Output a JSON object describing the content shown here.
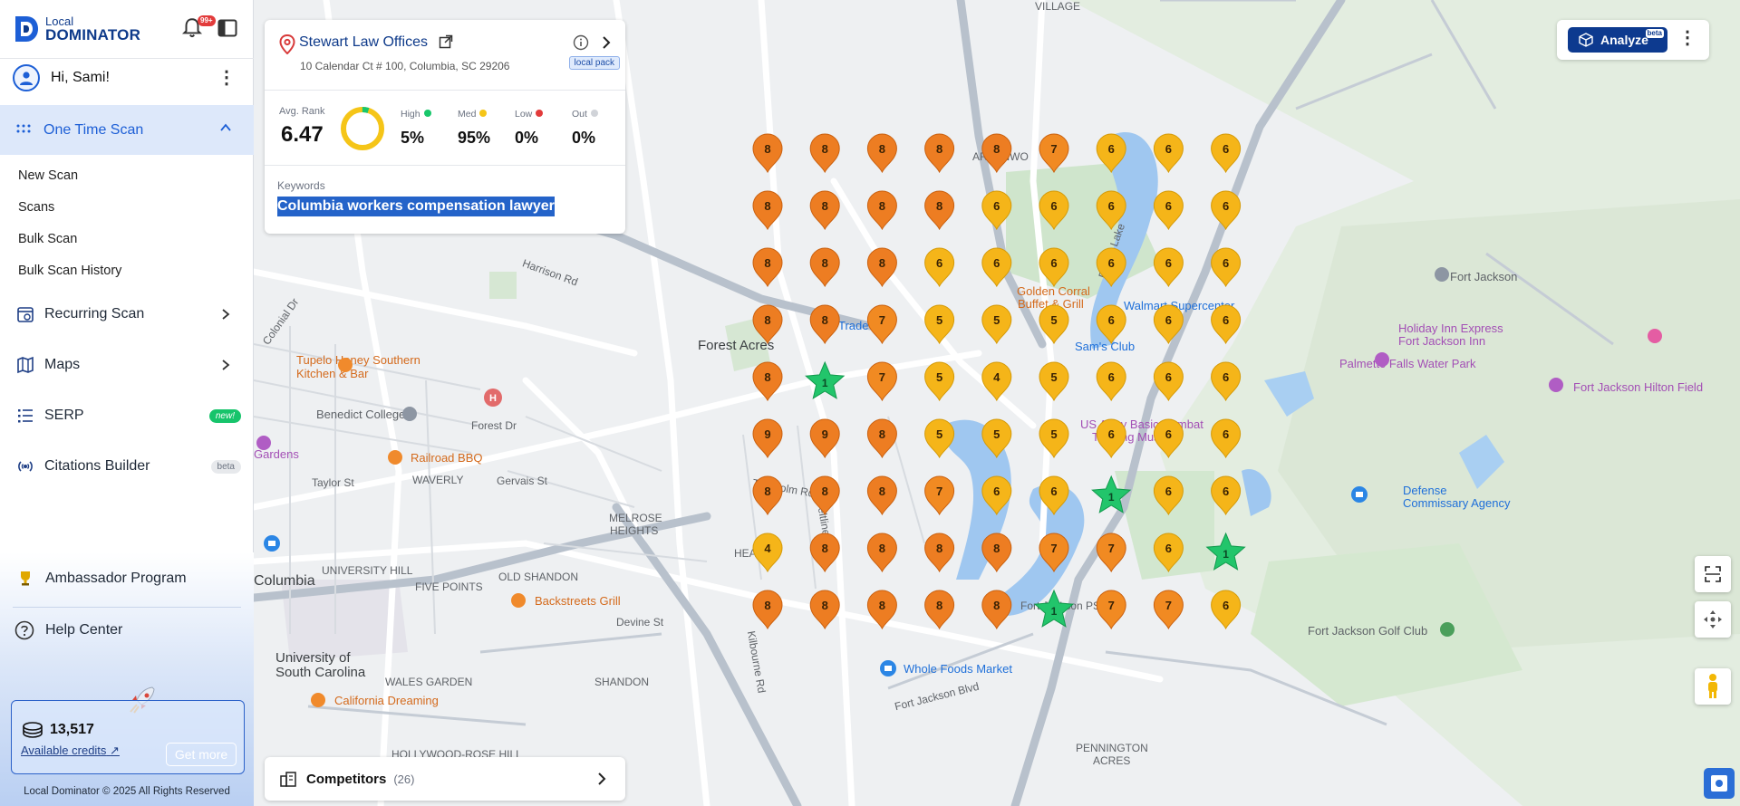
{
  "header": {
    "logo_small": "Local",
    "logo_big": "DOMINATOR",
    "notif_count": "99+"
  },
  "user": {
    "greeting": "Hi, Sami!"
  },
  "nav": {
    "active": "One Time Scan",
    "sub_items": [
      "New Scan",
      "Scans",
      "Bulk Scan",
      "Bulk Scan History"
    ],
    "items": [
      {
        "label": "Recurring Scan"
      },
      {
        "label": "Maps"
      },
      {
        "label": "SERP",
        "tag": "new!"
      },
      {
        "label": "Citations Builder",
        "tag": "beta"
      }
    ]
  },
  "bottom": {
    "ambassador": "Ambassador Program",
    "help": "Help Center",
    "credits": "13,517",
    "credits_label": "Available credits",
    "get_more": "Get more",
    "footer": "Local Dominator © 2025 All Rights Reserved"
  },
  "business": {
    "name": "Stewart Law Offices",
    "address": "10 Calendar Ct # 100, Columbia, SC 29206",
    "badge": "local pack"
  },
  "stats": {
    "avg_label": "Avg. Rank",
    "avg_value": "6.47",
    "high_label": "High",
    "high_value": "5%",
    "med_label": "Med",
    "med_value": "95%",
    "low_label": "Low",
    "low_value": "0%",
    "out_label": "Out",
    "out_value": "0%",
    "colors": {
      "high": "#18c76b",
      "med": "#f5c518",
      "low": "#e23b3b",
      "out": "#d0d3d8"
    }
  },
  "keywords": {
    "label": "Keywords",
    "value": "Columbia workers compensation lawyer"
  },
  "competitors": {
    "label": "Competitors",
    "count": "(26)"
  },
  "analyze": {
    "label": "Analyze",
    "badge": "beta"
  },
  "map_labels": [
    "VILLAGE",
    "Forest Acres",
    "ARVENWO",
    "Tupelo Honey Southern",
    "Kitchen & Bar",
    "Benedict College",
    "Forest Dr",
    "Railroad BBQ",
    "WAVERLY",
    "Taylor St",
    "Gervais St",
    "Gardens",
    "Columbia",
    "UNIVERSITY HILL",
    "FIVE POINTS",
    "OLD SHANDON",
    "MELROSE",
    "HEIGHTS",
    "HEA",
    "Backstreets Grill",
    "Devine St",
    "University of",
    "South Carolina",
    "WALES GARDEN",
    "SHANDON",
    "California Dreaming",
    "Golden Corral",
    "Buffet & Grill",
    "Walmart Supercenter",
    "Sam's Club",
    "Fort Jackson",
    "Holiday Inn Express",
    "Fort Jackson Inn",
    "Palmetto Falls Water Park",
    "Fort Jackson Hilton Field",
    "US Army Basic Combat",
    "Training Museum",
    "Defense",
    "Commissary Agency",
    "Whole Foods Market",
    "Fort Jackson Golf Club",
    "PENNINGTON",
    "ACRES",
    "HOLLYWOOD-ROSE HILL",
    "Fort Jackson Blvd",
    "Harrison Rd",
    "Colonial Dr",
    "Trenholm Rd",
    "Kilbourne Rd",
    "Beltline Blvd",
    "Trade",
    "Forest Lake",
    "Fort Jackson PS"
  ],
  "grid": {
    "rows": [
      [
        8,
        8,
        8,
        8,
        8,
        7,
        6,
        6,
        6
      ],
      [
        8,
        8,
        8,
        8,
        6,
        6,
        6,
        6,
        6
      ],
      [
        8,
        8,
        8,
        6,
        6,
        6,
        6,
        6,
        6
      ],
      [
        8,
        8,
        7,
        5,
        5,
        5,
        6,
        6,
        6
      ],
      [
        8,
        1,
        7,
        5,
        4,
        5,
        6,
        6,
        6
      ],
      [
        9,
        9,
        8,
        5,
        5,
        5,
        6,
        6,
        6
      ],
      [
        8,
        8,
        8,
        7,
        6,
        6,
        1,
        6,
        6
      ],
      [
        4,
        8,
        8,
        8,
        8,
        7,
        7,
        6,
        1
      ],
      [
        8,
        8,
        8,
        8,
        8,
        1,
        7,
        7,
        6
      ]
    ]
  }
}
